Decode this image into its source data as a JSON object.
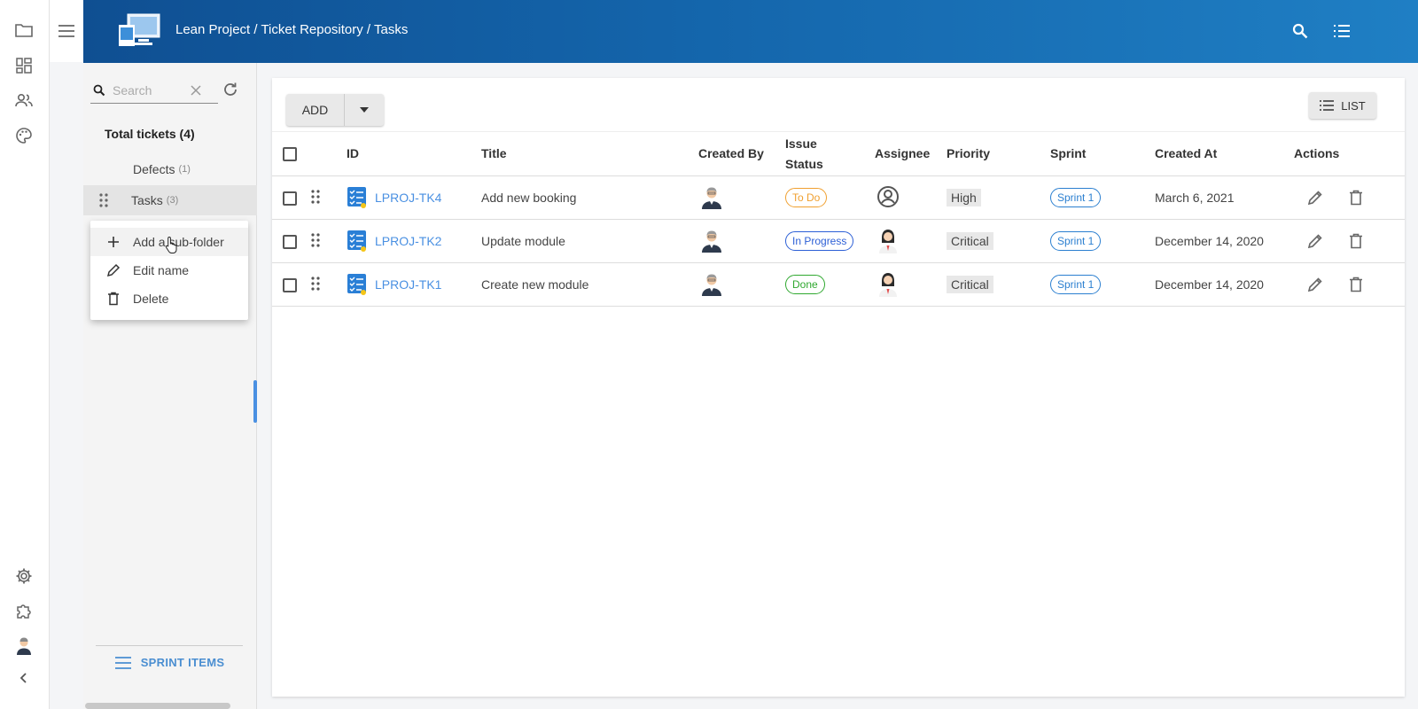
{
  "header": {
    "breadcrumb": "Lean Project / Ticket Repository / Tasks"
  },
  "rail": {
    "icons": [
      "folder-icon",
      "dashboard-icon",
      "people-icon",
      "palette-icon",
      "gear-icon",
      "puzzle-icon",
      "avatar",
      "chevron-left-icon"
    ]
  },
  "tree": {
    "search_placeholder": "Search",
    "total_label": "Total tickets (4)",
    "items": [
      {
        "label": "Defects",
        "count": "(1)"
      },
      {
        "label": "Tasks",
        "count": "(3)"
      }
    ],
    "context_menu": [
      {
        "label": "Add a sub-folder",
        "icon": "plus-icon"
      },
      {
        "label": "Edit name",
        "icon": "pencil-icon"
      },
      {
        "label": "Delete",
        "icon": "trash-icon"
      }
    ],
    "sprint_items_label": "SPRINT ITEMS"
  },
  "toolbar": {
    "add_label": "ADD",
    "list_label": "LIST"
  },
  "table": {
    "columns": {
      "id": "ID",
      "title": "Title",
      "created_by": "Created By",
      "issue_status_1": "Issue",
      "issue_status_2": "Status",
      "assignee": "Assignee",
      "priority": "Priority",
      "sprint": "Sprint",
      "created_at": "Created At",
      "actions": "Actions"
    },
    "rows": [
      {
        "id": "LPROJ-TK4",
        "title": "Add new booking",
        "status": "To Do",
        "status_color": "#f0a030",
        "assignee": "unassigned",
        "priority": "High",
        "sprint": "Sprint 1",
        "created_at": "March 6, 2021"
      },
      {
        "id": "LPROJ-TK2",
        "title": "Update module",
        "status": "In Progress",
        "status_color": "#2c5fd6",
        "assignee": "female",
        "priority": "Critical",
        "sprint": "Sprint 1",
        "created_at": "December 14, 2020"
      },
      {
        "id": "LPROJ-TK1",
        "title": "Create new module",
        "status": "Done",
        "status_color": "#2fa82f",
        "assignee": "female",
        "priority": "Critical",
        "sprint": "Sprint 1",
        "created_at": "December 14, 2020"
      }
    ]
  },
  "colors": {
    "header_start": "#0f4f92",
    "header_end": "#1f7fc4",
    "link": "#4a90e2",
    "sprint_pill": "#2b7fd0"
  }
}
